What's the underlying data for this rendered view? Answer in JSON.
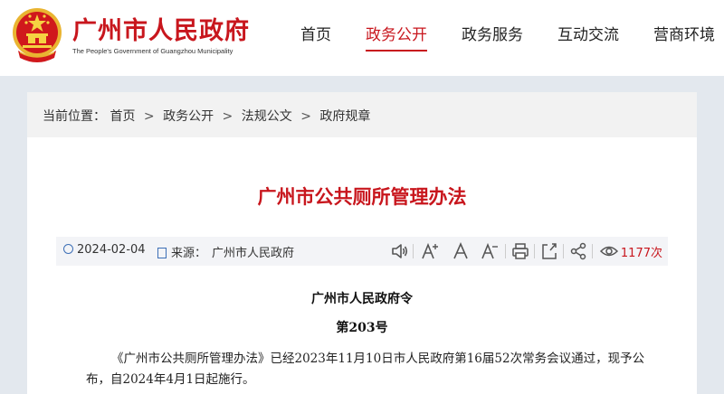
{
  "header": {
    "site_title": "广州市人民政府",
    "site_subtitle": "The People's Government of Guangzhou Municipality",
    "nav": [
      {
        "label": "首页",
        "active": false
      },
      {
        "label": "政务公开",
        "active": true
      },
      {
        "label": "政务服务",
        "active": false
      },
      {
        "label": "互动交流",
        "active": false
      },
      {
        "label": "营商环境",
        "active": false
      }
    ]
  },
  "breadcrumb": {
    "prefix": "当前位置：",
    "items": [
      "首页",
      "政务公开",
      "法规公文",
      "政府规章"
    ],
    "separator": ">"
  },
  "article": {
    "title": "广州市公共厕所管理办法",
    "date": "2024-02-04",
    "source_label": "来源：",
    "source": "广州市人民政府",
    "views": "1177次",
    "order_title": "广州市人民政府令",
    "order_number": "第203号",
    "body": "《广州市公共厕所管理办法》已经2023年11月10日市人民政府第16届52次常务会议通过，现予公布，自2024年4月1日起施行。"
  },
  "colors": {
    "brand_red": "#c8161d",
    "icon_blue": "#3d6fb6"
  },
  "toolbar_icons": [
    "speaker-icon",
    "font-increase-icon",
    "font-reset-icon",
    "font-decrease-icon",
    "print-icon",
    "share-external-icon",
    "share-icon",
    "eye-icon"
  ]
}
